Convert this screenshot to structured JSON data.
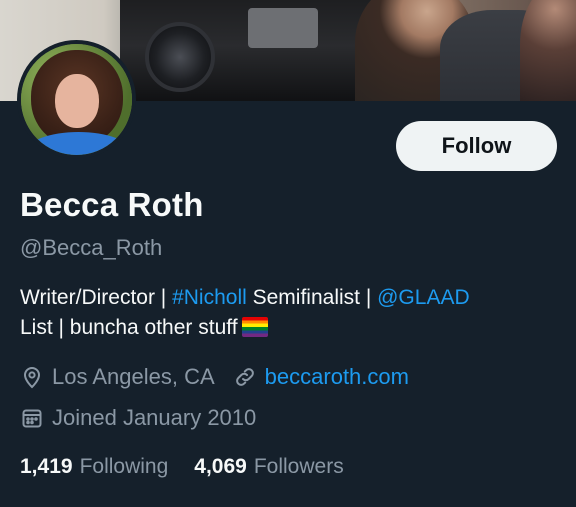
{
  "profile": {
    "name": "Becca Roth",
    "handle": "@Becca_Roth",
    "bio": {
      "line1_pre": "Writer/Director | ",
      "hashtag": "#Nicholl",
      "line1_mid": " Semifinalist | ",
      "mention": "@GLAAD",
      "line2": "List | buncha other stuff"
    },
    "location": "Los Angeles, CA",
    "website": "beccaroth.com",
    "joined": "Joined January 2010",
    "following_count": "1,419",
    "following_label": "Following",
    "followers_count": "4,069",
    "followers_label": "Followers"
  },
  "actions": {
    "follow_label": "Follow"
  },
  "icons": {
    "location": "map-pin-icon",
    "website": "link-icon",
    "joined": "calendar-icon",
    "flag": "rainbow-flag-icon"
  },
  "colors": {
    "background": "#15202b",
    "accent": "#1d9bf0",
    "secondary_text": "#8b98a5",
    "button_bg": "#eff3f4"
  }
}
